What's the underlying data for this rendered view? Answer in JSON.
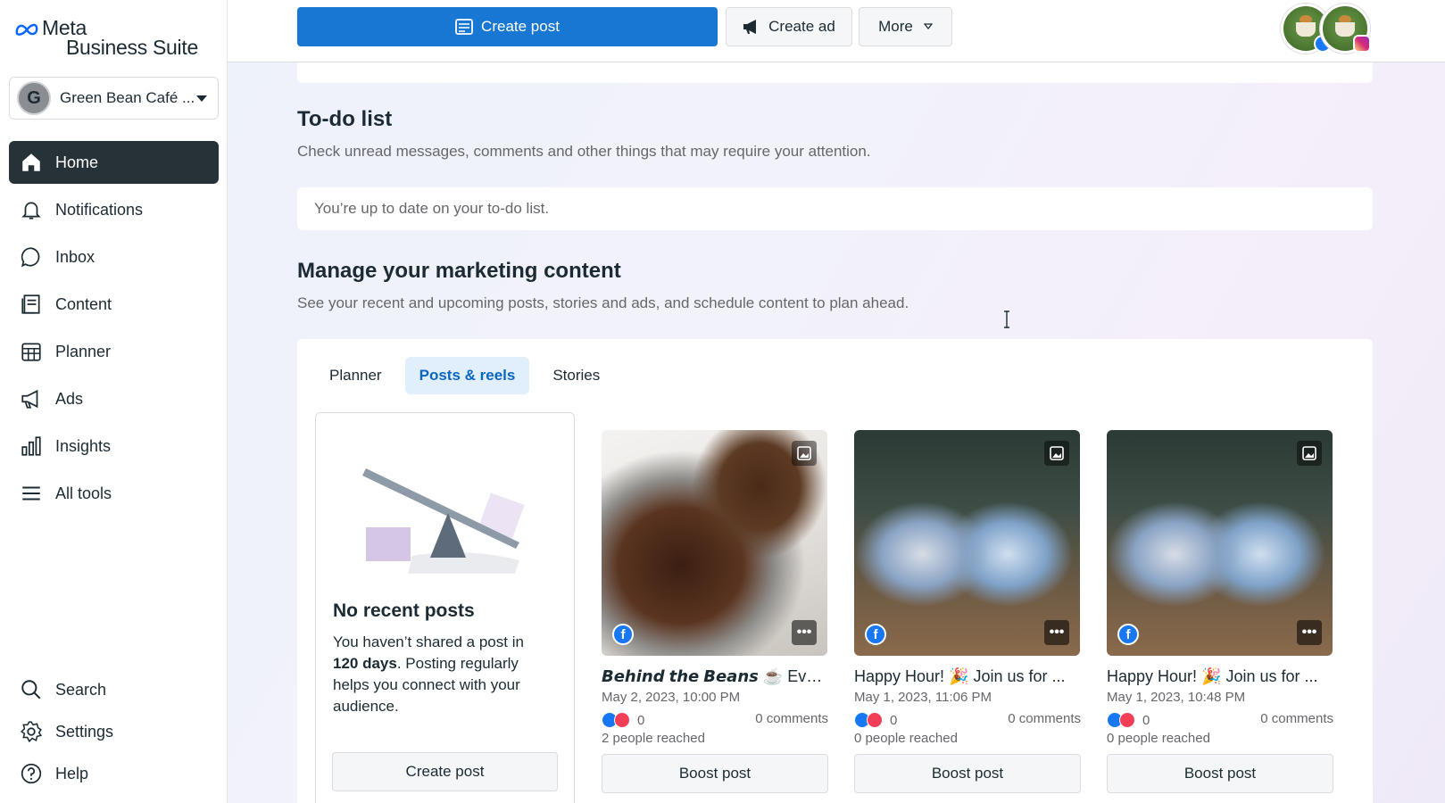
{
  "brand": {
    "line1": "Meta",
    "line2": "Business Suite"
  },
  "account": {
    "initial": "G",
    "name": "Green Bean Café ..."
  },
  "nav": {
    "items": [
      {
        "label": "Home",
        "icon": "home-icon",
        "active": true
      },
      {
        "label": "Notifications",
        "icon": "bell-icon"
      },
      {
        "label": "Inbox",
        "icon": "chat-bubble-icon"
      },
      {
        "label": "Content",
        "icon": "content-icon"
      },
      {
        "label": "Planner",
        "icon": "calendar-grid-icon"
      },
      {
        "label": "Ads",
        "icon": "megaphone-icon"
      },
      {
        "label": "Insights",
        "icon": "bar-chart-icon"
      },
      {
        "label": "All tools",
        "icon": "menu-icon"
      }
    ],
    "bottom": [
      {
        "label": "Search",
        "icon": "search-icon"
      },
      {
        "label": "Settings",
        "icon": "gear-icon"
      },
      {
        "label": "Help",
        "icon": "help-icon"
      }
    ]
  },
  "topbar": {
    "create_post": "Create post",
    "create_ad": "Create ad",
    "more": "More"
  },
  "todo": {
    "title": "To-do list",
    "subtitle": "Check unread messages, comments and other things that may require your attention.",
    "status": "You’re up to date on your to-do list."
  },
  "marketing": {
    "title": "Manage your marketing content",
    "subtitle": "See your recent and upcoming posts, stories and ads, and schedule content to plan ahead.",
    "tabs": [
      {
        "label": "Planner"
      },
      {
        "label": "Posts & reels",
        "active": true
      },
      {
        "label": "Stories"
      }
    ],
    "empty": {
      "title": "No recent posts",
      "text_pre": "You haven’t shared a post in ",
      "text_bold": "120 days",
      "text_post": ". Posting regularly helps you connect with your audience.",
      "button": "Create post"
    },
    "posts": [
      {
        "title": "𝘽𝙚𝙝𝙞𝙣𝙙 𝙩𝙝𝙚 𝘽𝙚𝙖𝙣𝙨 ☕ Eve...",
        "date": "May 2, 2023, 10:00 PM",
        "reactions": "0",
        "comments": "0 comments",
        "reached": "2 people reached",
        "button": "Boost post"
      },
      {
        "title": "Happy Hour! 🎉 Join us for ...",
        "date": "May 1, 2023, 11:06 PM",
        "reactions": "0",
        "comments": "0 comments",
        "reached": "0 people reached",
        "button": "Boost post"
      },
      {
        "title": "Happy Hour! 🎉 Join us for ...",
        "date": "May 1, 2023, 10:48 PM",
        "reactions": "0",
        "comments": "0 comments",
        "reached": "0 people reached",
        "button": "Boost post"
      }
    ]
  },
  "colors": {
    "primary": "#1877d2",
    "active_nav": "#263238",
    "active_tab_bg": "#e1eefb",
    "active_tab_text": "#0a66c2"
  }
}
